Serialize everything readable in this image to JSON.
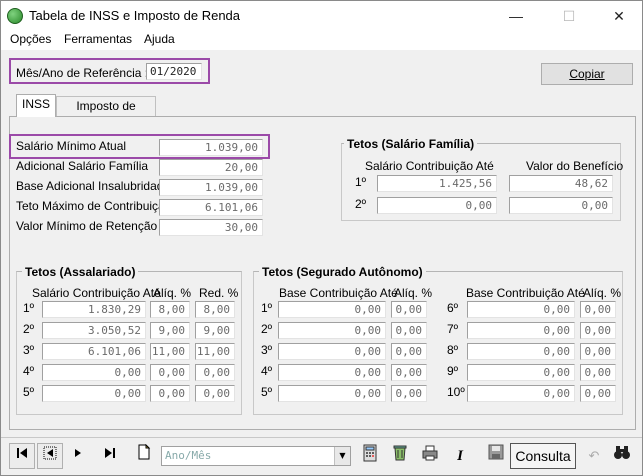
{
  "window": {
    "title": "Tabela de INSS e Imposto de Renda",
    "minimize": "—",
    "maximize": "☐",
    "close": "✕"
  },
  "menu": [
    "Opções",
    "Ferramentas",
    "Ajuda"
  ],
  "reference": {
    "label": "Mês/Ano de Referência :",
    "value": "01/2020"
  },
  "copy_button": "Copiar",
  "tabs": [
    {
      "label": "INSS",
      "active": true
    },
    {
      "label": "Imposto de Renda",
      "active": false
    }
  ],
  "inss": {
    "fields": [
      {
        "label": "Salário Mínimo Atual",
        "value": "1.039,00"
      },
      {
        "label": "Adicional Salário Família",
        "value": "20,00"
      },
      {
        "label": "Base Adicional Insalubridade",
        "value": "1.039,00"
      },
      {
        "label": "Teto Máximo de Contribuição",
        "value": "6.101,06"
      },
      {
        "label": "Valor Mínimo de Retenção",
        "value": "30,00"
      }
    ],
    "salario_familia": {
      "title": "Tetos (Salário Família)",
      "col_base": "Salário Contribuição Até",
      "col_benefit": "Valor do Benefício",
      "rows": [
        {
          "n": "1º",
          "base": "1.425,56",
          "benefit": "48,62"
        },
        {
          "n": "2º",
          "base": "0,00",
          "benefit": "0,00"
        }
      ]
    },
    "assalariado": {
      "title": "Tetos (Assalariado)",
      "col_base": "Salário Contribuição Até",
      "col_aliq": "Alíq. %",
      "col_red": "Red. %",
      "rows": [
        {
          "n": "1º",
          "base": "1.830,29",
          "aliq": "8,00",
          "red": "8,00"
        },
        {
          "n": "2º",
          "base": "3.050,52",
          "aliq": "9,00",
          "red": "9,00"
        },
        {
          "n": "3º",
          "base": "6.101,06",
          "aliq": "11,00",
          "red": "11,00"
        },
        {
          "n": "4º",
          "base": "0,00",
          "aliq": "0,00",
          "red": "0,00"
        },
        {
          "n": "5º",
          "base": "0,00",
          "aliq": "0,00",
          "red": "0,00"
        }
      ]
    },
    "autonomo": {
      "title": "Tetos (Segurado Autônomo)",
      "col_base": "Base Contribuição Até",
      "col_aliq": "Alíq. %",
      "rows": [
        {
          "n": "1º",
          "base": "0,00",
          "aliq": "0,00"
        },
        {
          "n": "2º",
          "base": "0,00",
          "aliq": "0,00"
        },
        {
          "n": "3º",
          "base": "0,00",
          "aliq": "0,00"
        },
        {
          "n": "4º",
          "base": "0,00",
          "aliq": "0,00"
        },
        {
          "n": "5º",
          "base": "0,00",
          "aliq": "0,00"
        },
        {
          "n": "6º",
          "base": "0,00",
          "aliq": "0,00"
        },
        {
          "n": "7º",
          "base": "0,00",
          "aliq": "0,00"
        },
        {
          "n": "8º",
          "base": "0,00",
          "aliq": "0,00"
        },
        {
          "n": "9º",
          "base": "0,00",
          "aliq": "0,00"
        },
        {
          "n": "10º",
          "base": "0,00",
          "aliq": "0,00"
        }
      ]
    }
  },
  "toolbar": {
    "period_placeholder": "Ano/Mês",
    "consulta": "Consulta",
    "icons": [
      "first-record-icon",
      "previous-record-icon",
      "next-record-icon",
      "last-record-icon",
      "new-document-icon",
      "calculator-icon",
      "recycle-icon",
      "print-icon",
      "italic-icon",
      "save-icon",
      "undo-icon",
      "binoculars-icon"
    ]
  },
  "colors": {
    "highlight": "#9b4aa8"
  }
}
